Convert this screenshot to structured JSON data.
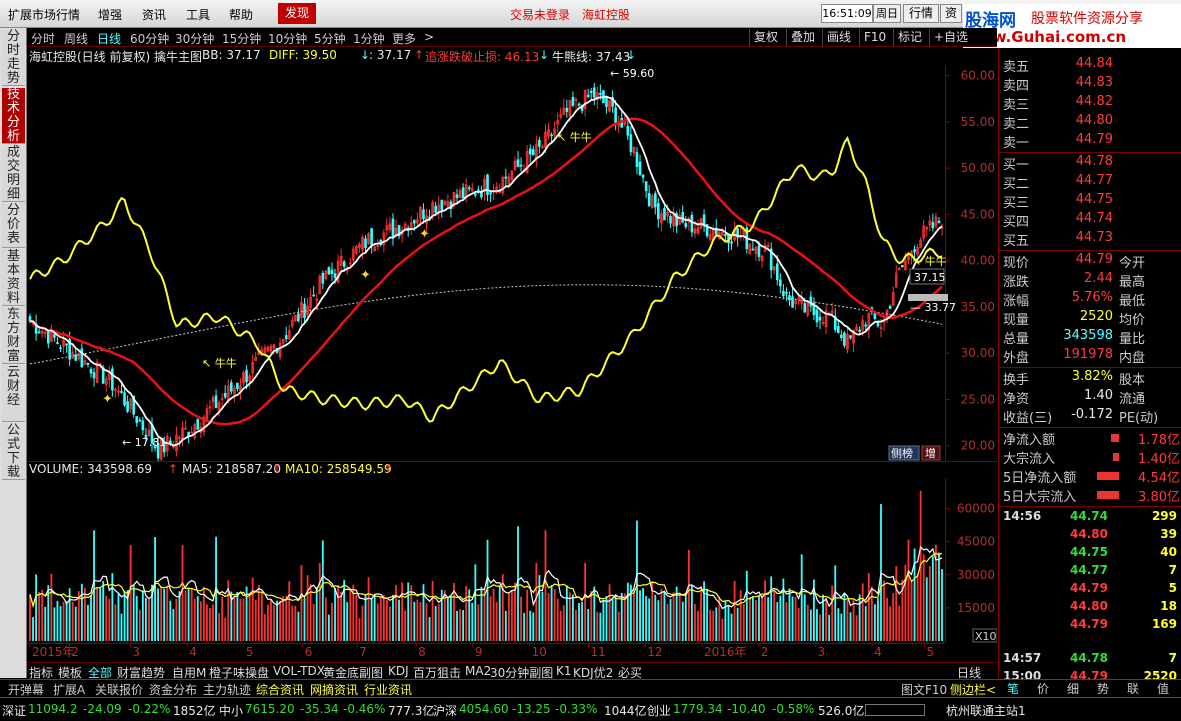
{
  "menu": {
    "items": [
      "扩展市场行情",
      "增强",
      "资讯",
      "工具",
      "帮助"
    ],
    "discover": "发现",
    "msg1": "交易未登录",
    "msg2": "海虹控股",
    "time": "16:51:09",
    "weekday": "周日",
    "market_btn": "行情",
    "right_btn": "资"
  },
  "watermark": {
    "brand": "股海网",
    "slogan": "股票软件资源分享",
    "url": "www.Guhai.com.cn"
  },
  "left_tabs": [
    {
      "label": "分时走势"
    },
    {
      "label": "技术分析"
    },
    {
      "label": "成交明细"
    },
    {
      "label": "分价表"
    },
    {
      "label": "基本资料"
    },
    {
      "label": "东方财富"
    },
    {
      "label": "云财经"
    },
    {
      "label": "公式下载"
    }
  ],
  "periods": [
    "分时",
    "周线",
    "日线",
    "60分钟",
    "30分钟",
    "15分钟",
    "10分钟",
    "5分钟",
    "1分钟",
    "更多",
    ">"
  ],
  "right_tools": [
    "复权",
    "叠加",
    "画线",
    "F10",
    "标记",
    "+自选"
  ],
  "indicator_line": {
    "title": "海虹控股(日线 前复权) 擒牛主图",
    "bb": "BB: 37.17",
    "diff": "DIFF: 39.50",
    "diff_arrow": "↓",
    "v3": ": 37.17",
    "v3_arrow": "↑",
    "stop": "追涨跌破止损: 46.13",
    "stop_arrow": "↓",
    "bull": "牛熊线: 37.43",
    "bull_arrow": "↓"
  },
  "main_axis": {
    "labels": [
      "60.00",
      "55.00",
      "50.00",
      "45.00",
      "40.00",
      "35.00",
      "30.00",
      "25.00",
      "20.00"
    ]
  },
  "annotations": {
    "high": "59.60",
    "low": "17.81",
    "bull1": "牛牛",
    "bull2": "牛牛",
    "bull3": "牛牛",
    "bull4": "牛牛",
    "level1": "37.15",
    "level2": "33.77",
    "btn1": "侧榜",
    "btn2": "增"
  },
  "volume_line": {
    "vol": "VOLUME: 343598.69",
    "vol_arrow": "↑",
    "ma5": "MA5: 218587.20",
    "ma5_arrow": "↑",
    "ma10": "MA10: 258549.59",
    "ma10_arrow": "↑"
  },
  "vol_axis": {
    "labels": [
      "60000",
      "45000",
      "30000",
      "15000"
    ],
    "unit": "X10"
  },
  "dates": [
    "2015年",
    "2",
    "3",
    "4",
    "5",
    "6",
    "7",
    "8",
    "9",
    "10",
    "11",
    "12",
    "2016年",
    "2",
    "3",
    "4",
    "5"
  ],
  "period_label": "日线",
  "chart_data": {
    "type": "candlestick",
    "ylim": [
      19.0,
      60.5
    ],
    "high": 59.6,
    "low": 17.81,
    "bb": 37.17,
    "diff": 39.5,
    "stop": 46.13,
    "bull_bear_line": 37.43,
    "vol_last": 343598.69,
    "vol_ma5": 218587.2,
    "vol_ma10": 258549.59,
    "vol_ylim": [
      0,
      72000
    ]
  },
  "ind_tabs": [
    "指标",
    "模板",
    "全部",
    "财富趋势",
    "自用M",
    "橙子味操盘",
    "VOL-TDX",
    "黄金底副图",
    "KDJ",
    "百万狙击",
    "MA2",
    "30分钟副图",
    "K1",
    "KDJ优2",
    "必买"
  ],
  "bottom_tabs": [
    "开弹幕",
    "扩展A",
    "关联报价",
    "资金分布",
    "主力轨迹",
    "综合资讯",
    "网摘资讯",
    "行业资讯",
    "图文F10",
    "侧边栏<"
  ],
  "status": {
    "sh_label": "深证",
    "sh_val": "11094.2",
    "sh_chg": "-24.09",
    "sh_pct": "-0.22%",
    "sh_amt": "1852亿",
    "zx_label": "中小",
    "zx_val": "7615.20",
    "zx_chg": "-35.34",
    "zx_pct": "-0.46%",
    "zx_amt": "777.3亿",
    "hs_label": "沪深",
    "hs_val": "4054.60",
    "hs_chg": "-13.25",
    "hs_pct": "-0.33%",
    "hs_amt": "1044亿",
    "cy_label": "创业",
    "cy_val": "1779.34",
    "cy_chg": "-10.40",
    "cy_pct": "-0.58%",
    "cy_amt": "526.0亿",
    "station": "杭州联通主站1"
  },
  "quote": {
    "asks": [
      {
        "l": "卖五",
        "p": "44.84"
      },
      {
        "l": "卖四",
        "p": "44.83"
      },
      {
        "l": "卖三",
        "p": "44.82"
      },
      {
        "l": "卖二",
        "p": "44.80"
      },
      {
        "l": "卖一",
        "p": "44.79"
      }
    ],
    "bids": [
      {
        "l": "买一",
        "p": "44.78"
      },
      {
        "l": "买二",
        "p": "44.77"
      },
      {
        "l": "买三",
        "p": "44.75"
      },
      {
        "l": "买四",
        "p": "44.74"
      },
      {
        "l": "买五",
        "p": "44.73"
      }
    ],
    "stats": [
      {
        "l": "现价",
        "v": "44.79",
        "l2": "今开"
      },
      {
        "l": "涨跌",
        "v": "2.44",
        "l2": "最高"
      },
      {
        "l": "涨幅",
        "v": "5.76%",
        "l2": "最低"
      },
      {
        "l": "现量",
        "v": "2520",
        "l2": "均价"
      },
      {
        "l": "总量",
        "v": "343598",
        "l2": "量比"
      },
      {
        "l": "外盘",
        "v": "191978",
        "l2": "内盘"
      }
    ],
    "stats2": [
      {
        "l": "换手",
        "v": "3.82%",
        "l2": "股本"
      },
      {
        "l": "净资",
        "v": "1.40",
        "l2": "流通"
      },
      {
        "l": "收益(三)",
        "v": "-0.172",
        "l2": "PE(动)"
      }
    ],
    "flow": [
      {
        "l": "净流入额",
        "v": "1.78亿"
      },
      {
        "l": "大宗流入",
        "v": "1.40亿"
      },
      {
        "l": "5日净流入额",
        "v": "4.54亿"
      },
      {
        "l": "5日大宗流入",
        "v": "3.80亿"
      }
    ],
    "ticks": [
      {
        "t": "14:56",
        "p": "44.74",
        "q": "299"
      },
      {
        "t": "",
        "p": "44.80",
        "q": "39"
      },
      {
        "t": "",
        "p": "44.75",
        "q": "40"
      },
      {
        "t": "",
        "p": "44.77",
        "q": "7"
      },
      {
        "t": "",
        "p": "44.79",
        "q": "5"
      },
      {
        "t": "",
        "p": "44.80",
        "q": "18"
      },
      {
        "t": "",
        "p": "44.79",
        "q": "169"
      },
      {
        "t": "14:57",
        "p": "44.78",
        "q": "7"
      },
      {
        "t": "15:00",
        "p": "44.79",
        "q": "2520"
      }
    ],
    "bottom": [
      "笔",
      "价",
      "细",
      "势",
      "联",
      "值"
    ]
  }
}
